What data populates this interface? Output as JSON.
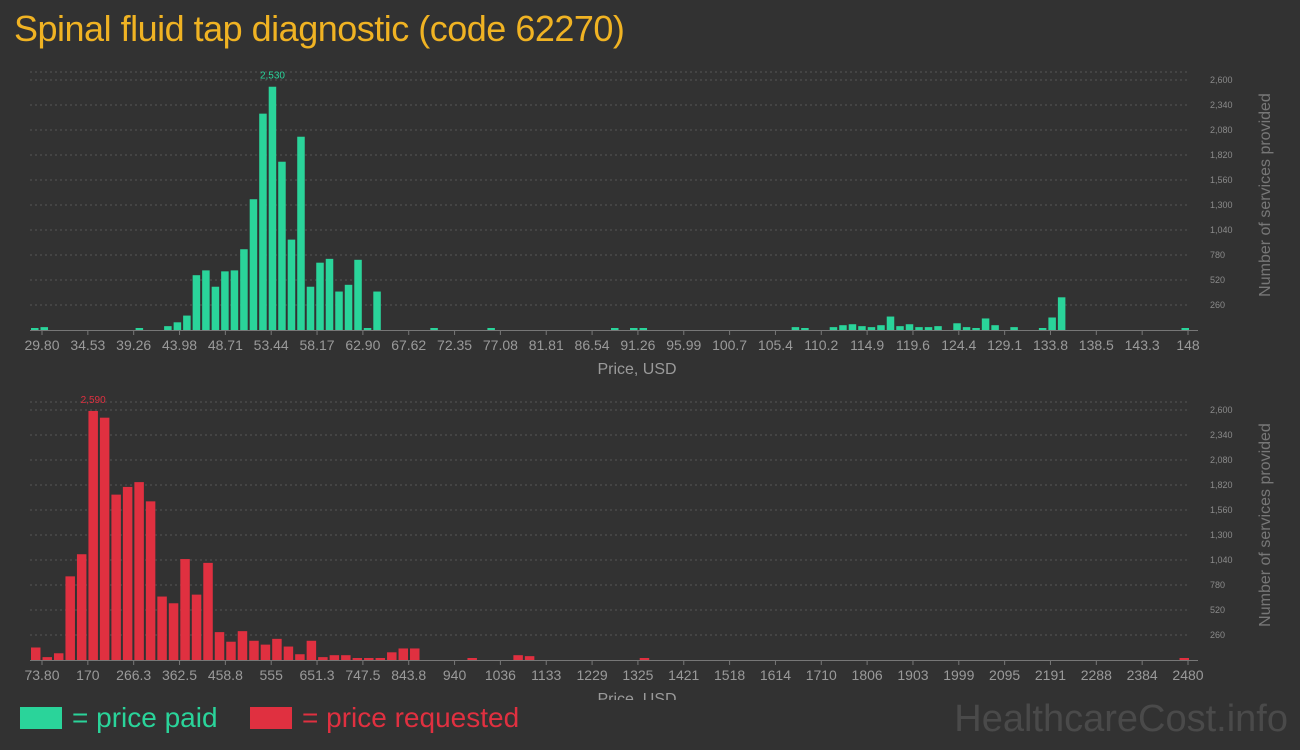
{
  "title": "Spinal fluid tap diagnostic (code 62270)",
  "legend": {
    "paid_label": "= price paid",
    "requested_label": "= price requested"
  },
  "watermark": "HealthcareCost.info",
  "colors": {
    "paid": "#2ad49a",
    "requested": "#e03040",
    "title": "#f0b323",
    "background": "#323232"
  },
  "chart_data": [
    {
      "type": "bar",
      "series": [
        {
          "name": "price paid",
          "values": [
            20,
            30,
            0,
            0,
            0,
            0,
            0,
            0,
            0,
            0,
            0,
            10,
            0,
            0,
            40,
            80,
            150,
            570,
            620,
            450,
            610,
            620,
            840,
            1360,
            2250,
            2530,
            1750,
            940,
            2010,
            450,
            700,
            740,
            400,
            470,
            730,
            20,
            400,
            0,
            0,
            0,
            0,
            0,
            10,
            0,
            0,
            0,
            0,
            0,
            10,
            0,
            0,
            0,
            0,
            0,
            0,
            0,
            0,
            0,
            0,
            0,
            0,
            10,
            0,
            10,
            10,
            0,
            0,
            0,
            0,
            0,
            0,
            0,
            0,
            0,
            0,
            0,
            0,
            0,
            0,
            0,
            30,
            20,
            0,
            0,
            30,
            50,
            60,
            40,
            30,
            50,
            140,
            40,
            60,
            30,
            30,
            40,
            0,
            70,
            30,
            20,
            120,
            50,
            0,
            30,
            0,
            0,
            10,
            130,
            340,
            0,
            0,
            0,
            0,
            0,
            0,
            0,
            0,
            0,
            0,
            0,
            0,
            20
          ]
        }
      ],
      "x_tick_labels": [
        "29.80",
        "34.53",
        "39.26",
        "43.98",
        "48.71",
        "53.44",
        "58.17",
        "62.90",
        "67.62",
        "72.35",
        "77.08",
        "81.81",
        "86.54",
        "91.26",
        "95.99",
        "100.7",
        "105.4",
        "110.2",
        "114.9",
        "119.6",
        "124.4",
        "129.1",
        "133.8",
        "138.5",
        "143.3",
        "148"
      ],
      "y_ticks": [
        "260",
        "520",
        "780",
        "1,040",
        "1,300",
        "1,560",
        "1,820",
        "2,080",
        "2,340",
        "2,600"
      ],
      "ylim": [
        0,
        2600
      ],
      "peak_label": "2,530",
      "xlabel": "Price, USD",
      "ylabel": "Number of services provided"
    },
    {
      "type": "bar",
      "series": [
        {
          "name": "price requested",
          "values": [
            130,
            30,
            70,
            870,
            1100,
            2590,
            2520,
            1720,
            1800,
            1850,
            1650,
            660,
            590,
            1050,
            680,
            1010,
            290,
            190,
            300,
            200,
            160,
            220,
            140,
            60,
            200,
            30,
            50,
            50,
            20,
            20,
            10,
            80,
            120,
            120,
            0,
            0,
            0,
            0,
            10,
            0,
            0,
            0,
            50,
            40,
            0,
            0,
            0,
            0,
            0,
            0,
            0,
            0,
            0,
            20,
            0,
            0,
            0,
            0,
            0,
            0,
            0,
            0,
            0,
            0,
            0,
            0,
            0,
            0,
            0,
            0,
            0,
            0,
            0,
            0,
            0,
            0,
            0,
            0,
            0,
            0,
            0,
            0,
            0,
            0,
            0,
            0,
            0,
            0,
            0,
            0,
            0,
            0,
            0,
            0,
            0,
            0,
            0,
            0,
            0,
            0,
            20
          ]
        }
      ],
      "x_tick_labels": [
        "73.80",
        "170",
        "266.3",
        "362.5",
        "458.8",
        "555",
        "651.3",
        "747.5",
        "843.8",
        "940",
        "1036",
        "1133",
        "1229",
        "1325",
        "1421",
        "1518",
        "1614",
        "1710",
        "1806",
        "1903",
        "1999",
        "2095",
        "2191",
        "2288",
        "2384",
        "2480"
      ],
      "y_ticks": [
        "260",
        "520",
        "780",
        "1,040",
        "1,300",
        "1,560",
        "1,820",
        "2,080",
        "2,340",
        "2,600"
      ],
      "ylim": [
        0,
        2600
      ],
      "peak_label": "2,590",
      "xlabel": "Price, USD",
      "ylabel": "Number of services provided"
    }
  ]
}
